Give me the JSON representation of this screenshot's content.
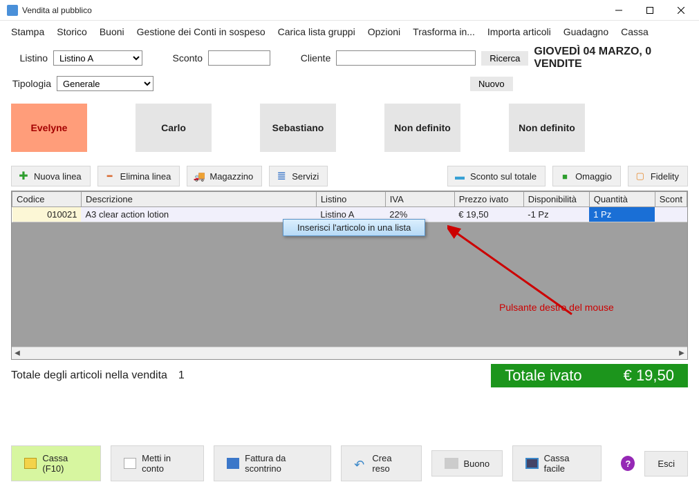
{
  "window": {
    "title": "Vendita al pubblico"
  },
  "menu": [
    "Stampa",
    "Storico",
    "Buoni",
    "Gestione dei Conti in sospeso",
    "Carica lista gruppi",
    "Opzioni",
    "Trasforma in...",
    "Importa articoli",
    "Guadagno",
    "Cassa"
  ],
  "filters": {
    "listino_label": "Listino",
    "listino_value": "Listino A",
    "sconto_label": "Sconto",
    "sconto_value": "",
    "cliente_label": "Cliente",
    "cliente_value": "",
    "ricerca": "Ricerca",
    "tipologia_label": "Tipologia",
    "tipologia_value": "Generale",
    "nuovo": "Nuovo"
  },
  "date_header": "GIOVEDÌ 04 MARZO, 0 VENDITE",
  "users": [
    "Evelyne",
    "Carlo",
    "Sebastiano",
    "Non definito",
    "Non definito"
  ],
  "active_user_index": 0,
  "toolbar": {
    "nuova_linea": "Nuova linea",
    "elimina_linea": "Elimina linea",
    "magazzino": "Magazzino",
    "servizi": "Servizi",
    "sconto_totale": "Sconto sul totale",
    "omaggio": "Omaggio",
    "fidelity": "Fidelity"
  },
  "grid": {
    "headers": [
      "Codice",
      "Descrizione",
      "Listino",
      "IVA",
      "Prezzo ivato",
      "Disponibilità",
      "Quantità",
      "Scont"
    ],
    "row": {
      "codice": "010021",
      "descrizione": "A3 clear action lotion",
      "listino": "Listino A",
      "iva": "22%",
      "prezzo": "€ 19,50",
      "disponibilita": "-1 Pz",
      "quantita": "1 Pz"
    }
  },
  "context_menu": "Inserisci l'articolo in una lista",
  "arrow_label": "Pulsante destro del mouse",
  "totals": {
    "items_label": "Totale degli articoli nella vendita",
    "items_count": "1",
    "box_label": "Totale ivato",
    "box_value": "€ 19,50"
  },
  "footer": {
    "cassa": "Cassa (F10)",
    "metti_in_conto": "Metti in conto",
    "fattura": "Fattura da scontrino",
    "crea_reso": "Crea reso",
    "buono": "Buono",
    "cassa_facile": "Cassa facile",
    "esci": "Esci"
  }
}
